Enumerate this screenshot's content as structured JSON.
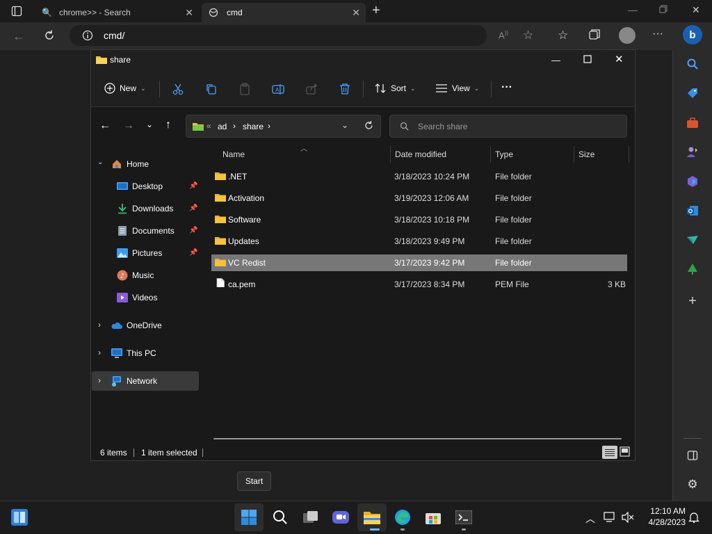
{
  "browser": {
    "tabs": [
      {
        "label": "chrome>> - Search"
      },
      {
        "label": "cmd"
      }
    ],
    "url": "cmd/",
    "new_tab": "+"
  },
  "explorer": {
    "title": "share",
    "toolbar": {
      "new_label": "New",
      "sort_label": "Sort",
      "view_label": "View",
      "more_label": "···"
    },
    "path": {
      "overflow": "«",
      "segments": [
        "ad",
        "share"
      ]
    },
    "search_placeholder": "Search share",
    "nav": {
      "home": "Home",
      "quick": [
        "Desktop",
        "Downloads",
        "Documents",
        "Pictures",
        "Music",
        "Videos"
      ],
      "onedrive": "OneDrive",
      "thispc": "This PC",
      "network": "Network"
    },
    "columns": {
      "name": "Name",
      "date": "Date modified",
      "type": "Type",
      "size": "Size"
    },
    "files": [
      {
        "name": ".NET",
        "date": "3/18/2023 10:24 PM",
        "type": "File folder",
        "size": "",
        "kind": "folder"
      },
      {
        "name": "Activation",
        "date": "3/19/2023 12:06 AM",
        "type": "File folder",
        "size": "",
        "kind": "folder"
      },
      {
        "name": "Software",
        "date": "3/18/2023 10:18 PM",
        "type": "File folder",
        "size": "",
        "kind": "folder"
      },
      {
        "name": "Updates",
        "date": "3/18/2023 9:49 PM",
        "type": "File folder",
        "size": "",
        "kind": "folder"
      },
      {
        "name": "VC Redist",
        "date": "3/17/2023 9:42 PM",
        "type": "File folder",
        "size": "",
        "kind": "folder",
        "selected": true
      },
      {
        "name": "ca.pem",
        "date": "3/17/2023 8:34 PM",
        "type": "PEM File",
        "size": "3 KB",
        "kind": "file"
      }
    ],
    "status": {
      "items": "6 items",
      "selected": "1 item selected"
    }
  },
  "tooltip": "Start",
  "taskbar": {
    "time": "12:10 AM",
    "date": "4/28/2023"
  },
  "colors": {
    "folder": "#f3c33f",
    "accent": "#0078d4",
    "selection": "#777777"
  }
}
